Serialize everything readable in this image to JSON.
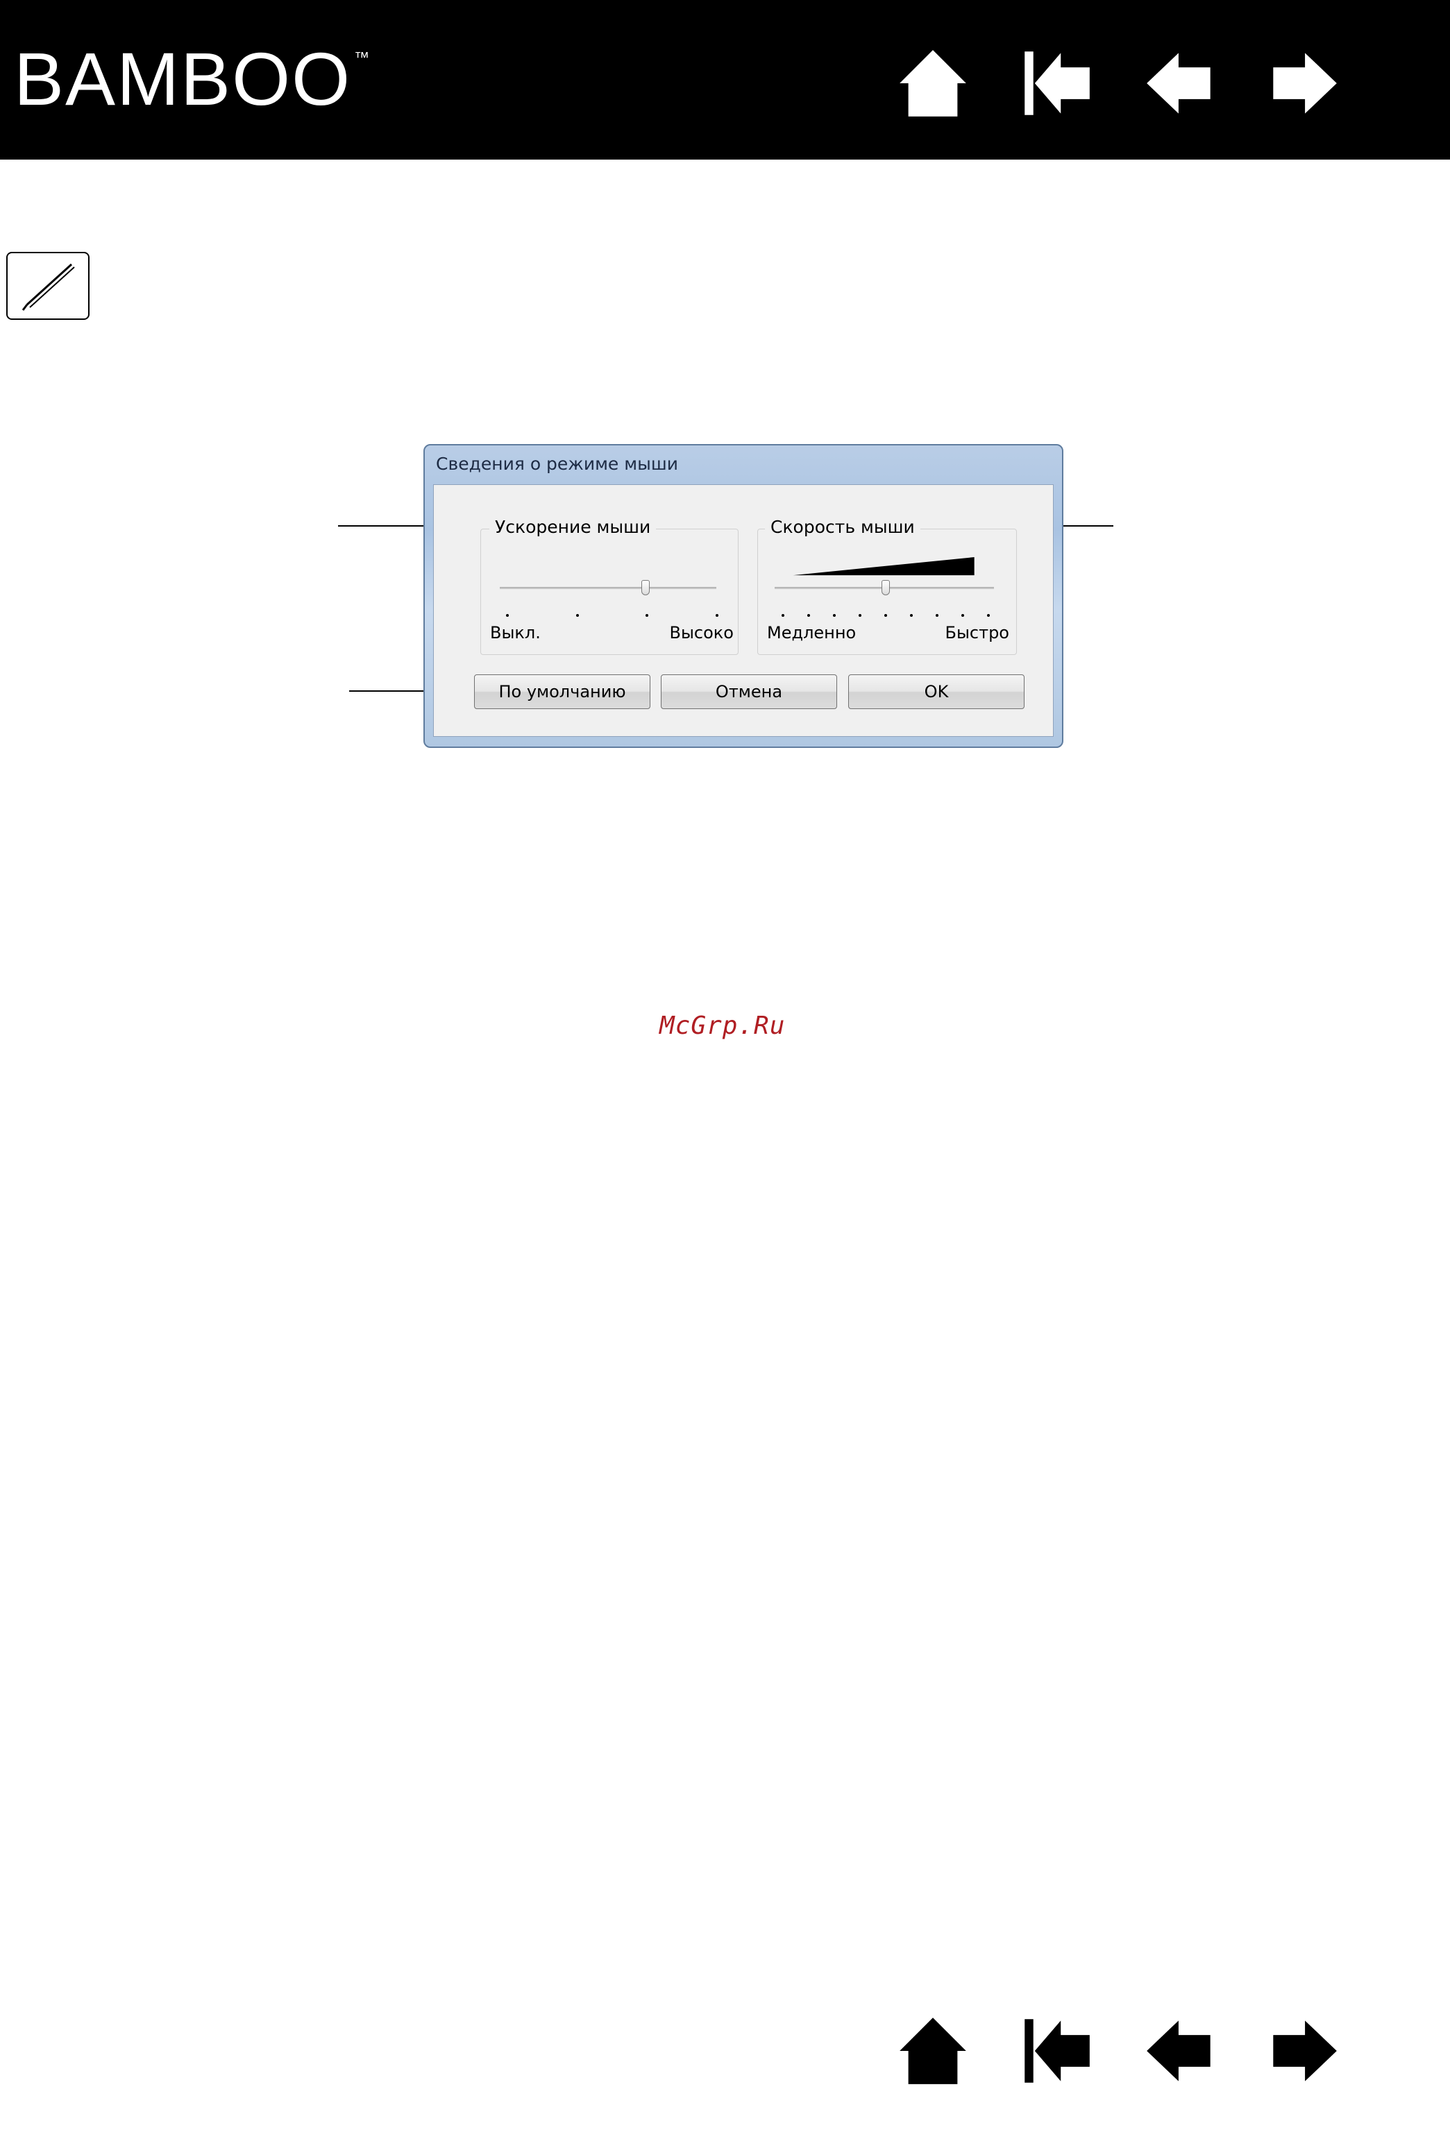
{
  "header": {
    "logo_text": "BAMBOO",
    "logo_tm": "™",
    "nav": [
      "home-icon",
      "first-page-icon",
      "previous-page-icon",
      "next-page-icon"
    ]
  },
  "pen_icon": "pen-tip-icon",
  "dialog": {
    "title": "Сведения о режиме мыши",
    "acceleration": {
      "label": "Ускорение мыши",
      "min_label": "Выкл.",
      "max_label": "Высоко",
      "ticks": 4,
      "level": 0.66
    },
    "speed": {
      "label": "Скорость мыши",
      "min_label": "Медленно",
      "max_label": "Быстро",
      "ticks": 9,
      "level": 0.5
    },
    "buttons": {
      "default": "По умолчанию",
      "cancel": "Отмена",
      "ok": "OK"
    }
  },
  "watermark": "McGrp.Ru",
  "colors": {
    "header_bg": "#000000",
    "watermark": "#b01e23",
    "dialog_frame": "#a9c3e2"
  }
}
